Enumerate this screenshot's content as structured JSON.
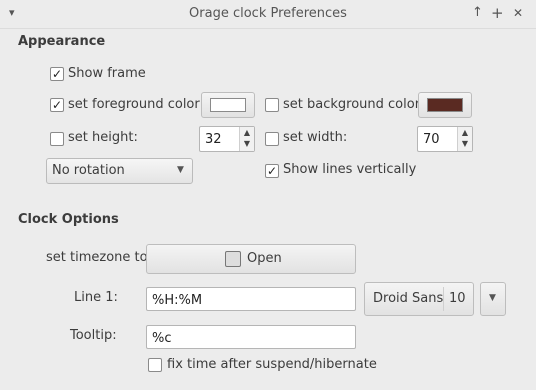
{
  "window": {
    "title": "Orage clock Preferences"
  },
  "titlebar_icons": {
    "menu": "▾",
    "up": "↑",
    "maximize": "+",
    "close": "✕"
  },
  "appearance": {
    "heading": "Appearance",
    "show_frame": {
      "label": "Show frame",
      "checked": true
    },
    "fg_color": {
      "label": "set foreground color:",
      "checked": true,
      "color": "#ffffff"
    },
    "bg_color": {
      "label": "set background color:",
      "checked": false,
      "color": "#5a2a22"
    },
    "height": {
      "label": "set height:",
      "checked": false,
      "value": "32"
    },
    "width": {
      "label": "set width:",
      "checked": false,
      "value": "70"
    },
    "rotation": {
      "value": "No rotation"
    },
    "lines_vertical": {
      "label": "Show lines vertically",
      "checked": true
    }
  },
  "clock_options": {
    "heading": "Clock Options",
    "timezone": {
      "label": "set timezone to:",
      "button_label": "Open"
    },
    "line1": {
      "label": "Line 1:",
      "value": "%H:%M",
      "font_name": "Droid Sans",
      "font_size": "10"
    },
    "tooltip": {
      "label": "Tooltip:",
      "value": "%c"
    },
    "fix_time": {
      "label": "fix time after suspend/hibernate",
      "checked": false
    }
  },
  "glyphs": {
    "check": "✓",
    "spin_up": "▲",
    "spin_down": "▼",
    "combo_arrow": "▼"
  }
}
